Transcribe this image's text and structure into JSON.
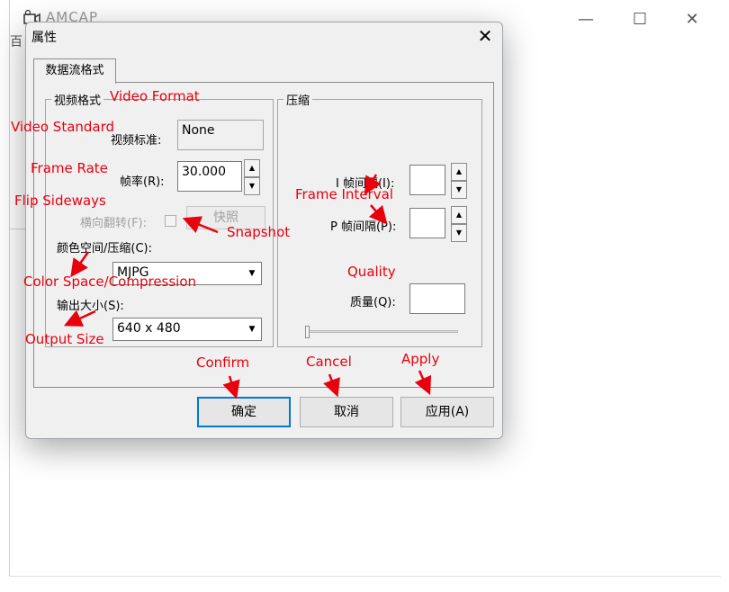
{
  "background_window": {
    "title": "AMCAP",
    "menu_fragment": "百",
    "controls": {
      "minimize": "—",
      "maximize": "☐",
      "close": "✕"
    }
  },
  "dialog": {
    "title": "属性",
    "close_glyph": "✕",
    "tab_label": "数据流格式",
    "video_format_group": {
      "title": "视频格式",
      "video_standard_label": "视频标准:",
      "video_standard_value": "None",
      "frame_rate_label": "帧率(R):",
      "frame_rate_value": "30.000",
      "flip_label": "横向翻转(F):",
      "snapshot_label": "快照",
      "color_space_label": "颜色空间/压缩(C):",
      "color_space_value": "MJPG",
      "output_size_label": "输出大小(S):",
      "output_size_value": "640 x 480"
    },
    "compression_group": {
      "title": "压缩",
      "i_frame_label": "I 帧间隔(I):",
      "p_frame_label": "P 帧间隔(P):",
      "quality_label": "质量(Q):",
      "quality_slider_level": 0
    },
    "buttons": {
      "ok": "确定",
      "cancel": "取消",
      "apply": "应用(A)"
    }
  },
  "annotations": {
    "color": "#e8000d",
    "video_format": "Video Format",
    "video_standard": "Video Standard",
    "frame_rate": "Frame Rate",
    "flip_sideways": "Flip Sideways",
    "snapshot": "Snapshot",
    "color_space": "Color Space/Compression",
    "output_size": "Output Size",
    "frame_interval": "Frame Interval",
    "quality": "Quality",
    "confirm": "Confirm",
    "cancel": "Cancel",
    "apply": "Apply"
  }
}
